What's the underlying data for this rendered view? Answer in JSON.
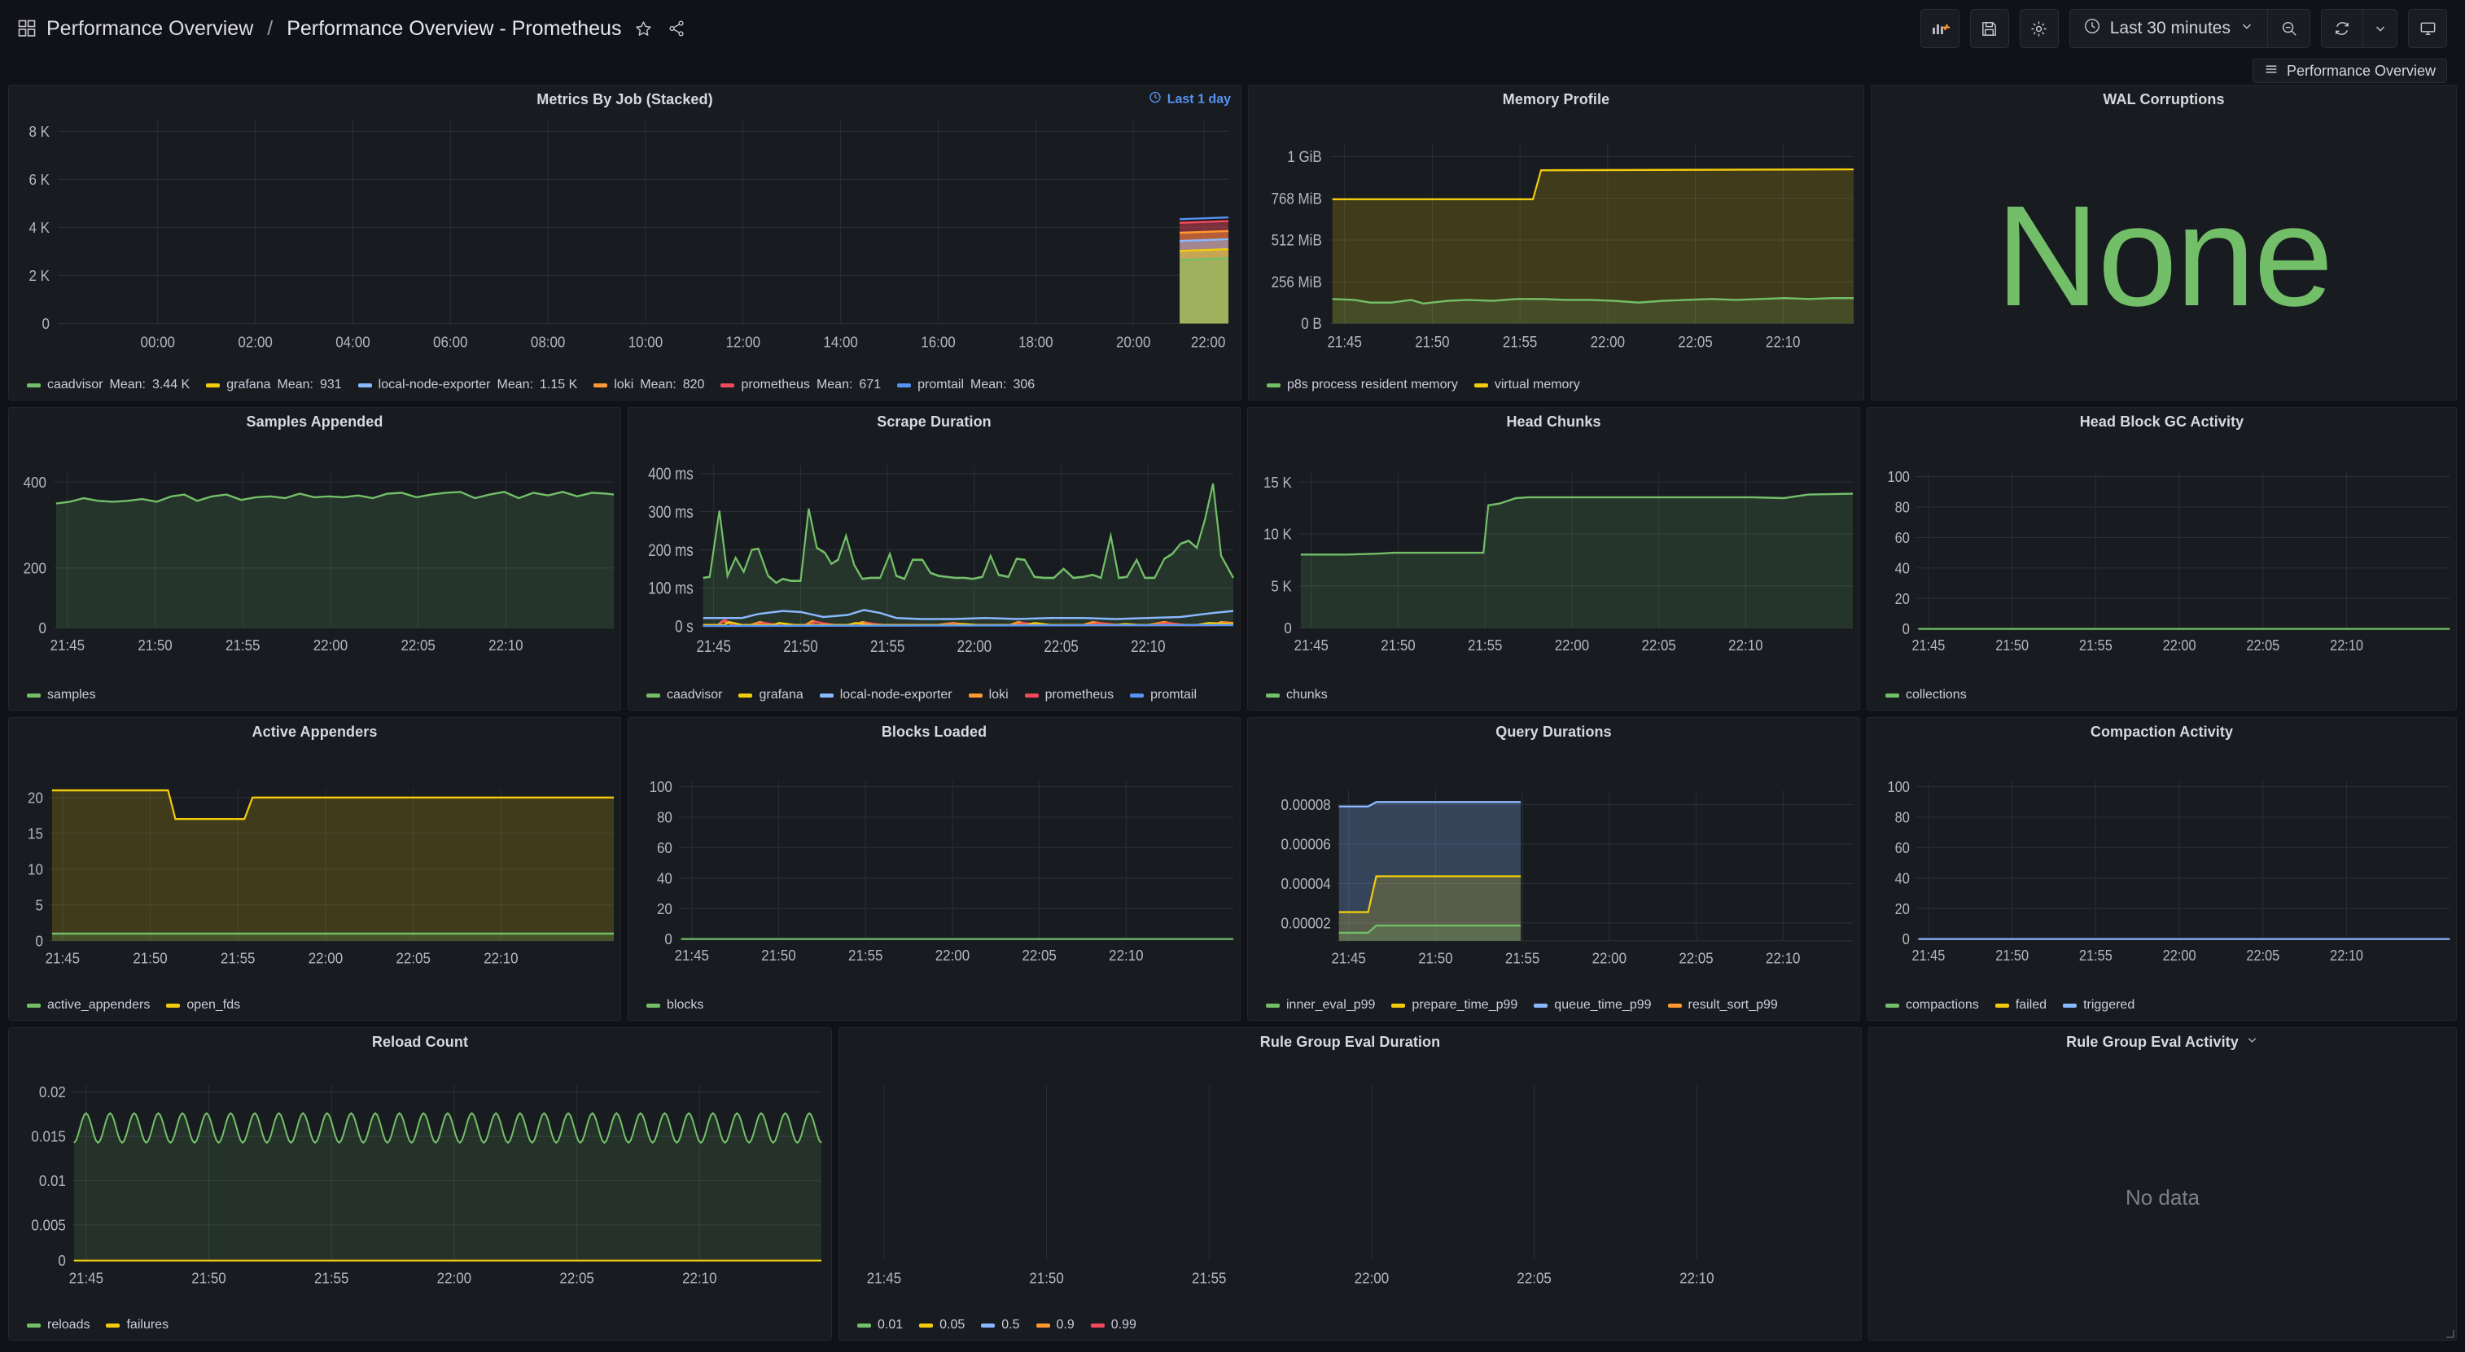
{
  "topbar": {
    "breadcrumb_root": "Performance Overview",
    "breadcrumb_sep": "/",
    "breadcrumb_current": "Performance Overview - Prometheus",
    "star_icon": "star-icon",
    "share_icon": "share-icon",
    "add_panel_label": "add-panel",
    "save_label": "save-dashboard",
    "settings_label": "dashboard-settings",
    "time_range": "Last 30 minutes",
    "clock_icon": "clock-icon",
    "caret_icon": "chevron-down-icon",
    "zoom_out_icon": "zoom-out-icon",
    "refresh_icon": "refresh-icon",
    "tv_icon": "tv-icon"
  },
  "subbar": {
    "dashboard_link": "Performance Overview",
    "menu_icon": "hamburger-icon"
  },
  "colors": {
    "green": "#73bf69",
    "yellow": "#f2cc0c",
    "blue": "#8ab8ff",
    "orange": "#ff9830",
    "red": "#f2495c",
    "blue2": "#5794f2",
    "accent": "#5794f2",
    "panel_bg": "#181b1f",
    "page_bg": "#111217",
    "text": "#ccccdc",
    "grid": "#2b2f36"
  },
  "chart_data": [
    {
      "id": "metrics-by-job",
      "type": "area",
      "title": "Metrics By Job (Stacked)",
      "badge": "Last 1 day",
      "stacked": true,
      "ylim": [
        0,
        9000
      ],
      "yticks": [
        "0",
        "2 K",
        "4 K",
        "6 K",
        "8 K"
      ],
      "ytick_values": [
        0,
        2000,
        4000,
        6000,
        8000
      ],
      "xticks": [
        "00:00",
        "02:00",
        "04:00",
        "06:00",
        "08:00",
        "10:00",
        "12:00",
        "14:00",
        "16:00",
        "18:00",
        "20:00",
        "22:00"
      ],
      "legend": [
        {
          "name": "caadvisor",
          "stat_label": "Mean:",
          "stat": "3.44 K",
          "color": "#73bf69",
          "value": 3440
        },
        {
          "name": "grafana",
          "stat_label": "Mean:",
          "stat": "931",
          "color": "#f2cc0c",
          "value": 931
        },
        {
          "name": "local-node-exporter",
          "stat_label": "Mean:",
          "stat": "1.15 K",
          "color": "#8ab8ff",
          "value": 1150
        },
        {
          "name": "loki",
          "stat_label": "Mean:",
          "stat": "820",
          "color": "#ff9830",
          "value": 820
        },
        {
          "name": "prometheus",
          "stat_label": "Mean:",
          "stat": "671",
          "color": "#f2495c",
          "value": 671
        },
        {
          "name": "promtail",
          "stat_label": "Mean:",
          "stat": "306",
          "color": "#5794f2",
          "value": 306
        }
      ],
      "note": "Series only present in the final ~2% of the time window (right edge), stacked to ~7.3 K"
    },
    {
      "id": "memory-profile",
      "type": "area",
      "title": "Memory Profile",
      "ylim": [
        0,
        1207959552
      ],
      "yticks": [
        "0 B",
        "256 MiB",
        "512 MiB",
        "768 MiB",
        "1 GiB"
      ],
      "ytick_values": [
        0,
        268435456,
        536870912,
        805306368,
        1073741824
      ],
      "xticks": [
        "21:45",
        "21:50",
        "21:55",
        "22:00",
        "22:05",
        "22:10"
      ],
      "series": [
        {
          "name": "p8s process resident memory",
          "color": "#73bf69",
          "values": [
            150,
            148,
            145,
            143,
            144,
            146,
            141,
            144,
            147,
            146,
            148,
            145,
            149,
            150,
            149,
            148,
            147,
            149,
            146,
            144,
            148,
            150,
            149,
            150,
            151,
            149,
            152,
            151,
            150,
            152
          ],
          "unit": "MiB"
        },
        {
          "name": "virtual memory",
          "color": "#f2cc0c",
          "values": [
            820,
            820,
            820,
            820,
            820,
            820,
            820,
            820,
            820,
            820,
            820,
            820,
            820,
            960,
            960,
            960,
            960,
            960,
            960,
            960,
            960,
            960,
            960,
            960,
            960,
            960,
            960,
            960,
            960,
            960
          ],
          "unit": "MiB"
        }
      ]
    },
    {
      "id": "wal-corruptions",
      "type": "stat",
      "title": "WAL Corruptions",
      "value": "None",
      "value_color": "#73bf69"
    },
    {
      "id": "samples-appended",
      "type": "area",
      "title": "Samples Appended",
      "ylim": [
        0,
        530
      ],
      "yticks": [
        "0",
        "200",
        "400"
      ],
      "ytick_values": [
        0,
        200,
        400
      ],
      "xticks": [
        "21:45",
        "21:50",
        "21:55",
        "22:00",
        "22:05",
        "22:10"
      ],
      "series": [
        {
          "name": "samples",
          "color": "#73bf69",
          "values": [
            455,
            458,
            468,
            463,
            461,
            459,
            462,
            465,
            461,
            470,
            478,
            463,
            472,
            476,
            465,
            470,
            472,
            468,
            480,
            471,
            474,
            470,
            477,
            470,
            467,
            475,
            480,
            481,
            472,
            478
          ]
        }
      ]
    },
    {
      "id": "scrape-duration",
      "type": "area",
      "title": "Scrape Duration",
      "ylim": [
        0,
        420
      ],
      "yticks": [
        "0 s",
        "100 ms",
        "200 ms",
        "300 ms",
        "400 ms"
      ],
      "ytick_values": [
        0,
        100,
        200,
        300,
        400
      ],
      "xticks": [
        "21:45",
        "21:50",
        "21:55",
        "22:00",
        "22:05",
        "22:10"
      ],
      "series": [
        {
          "name": "caadvisor",
          "color": "#73bf69",
          "values": [
            128,
            130,
            303,
            140,
            175,
            200,
            150,
            120,
            133,
            205,
            165,
            240,
            130,
            126,
            128,
            190,
            125,
            175,
            145,
            130,
            126,
            185,
            127,
            175,
            124,
            190,
            180,
            375
          ]
        },
        {
          "name": "grafana",
          "color": "#f2cc0c",
          "values": [
            3,
            3,
            12,
            4,
            10,
            3,
            3,
            3,
            9,
            4,
            8,
            3,
            3,
            3,
            3,
            8,
            3,
            3,
            4,
            8,
            3,
            3,
            4,
            3,
            3,
            5,
            6,
            10
          ]
        },
        {
          "name": "local-node-exporter",
          "color": "#8ab8ff",
          "values": [
            22,
            22,
            26,
            24,
            30,
            34,
            24,
            22,
            30,
            27,
            32,
            36,
            22,
            20,
            21,
            22,
            22,
            21,
            22,
            23,
            21,
            20,
            22,
            22,
            21,
            24,
            28,
            38
          ]
        },
        {
          "name": "loki",
          "color": "#ff9830",
          "values": [
            4,
            4,
            14,
            5,
            11,
            4,
            4,
            4,
            10,
            5,
            9,
            4,
            4,
            4,
            4,
            9,
            4,
            4,
            5,
            12,
            4,
            4,
            5,
            4,
            4,
            6,
            7,
            12
          ]
        },
        {
          "name": "prometheus",
          "color": "#f2495c",
          "values": [
            3,
            3,
            13,
            4,
            9,
            3,
            3,
            3,
            8,
            4,
            7,
            3,
            3,
            3,
            3,
            7,
            3,
            3,
            4,
            7,
            3,
            3,
            4,
            3,
            3,
            4,
            5,
            9
          ]
        },
        {
          "name": "promtail",
          "color": "#5794f2",
          "values": [
            2,
            2,
            3,
            2,
            3,
            2,
            2,
            2,
            3,
            2,
            3,
            2,
            2,
            2,
            2,
            3,
            2,
            2,
            2,
            3,
            2,
            2,
            2,
            2,
            2,
            2,
            3,
            4
          ]
        }
      ]
    },
    {
      "id": "head-chunks",
      "type": "area",
      "title": "Head Chunks",
      "ylim": [
        0,
        16500
      ],
      "yticks": [
        "0",
        "5 K",
        "10 K",
        "15 K"
      ],
      "ytick_values": [
        0,
        5000,
        10000,
        15000
      ],
      "xticks": [
        "21:45",
        "21:50",
        "21:55",
        "22:00",
        "22:05",
        "22:10"
      ],
      "series": [
        {
          "name": "chunks",
          "color": "#73bf69",
          "values": [
            7150,
            7150,
            7160,
            7200,
            7230,
            7240,
            7240,
            7240,
            7240,
            7240,
            7240,
            7250,
            13200,
            13400,
            13700,
            13720,
            13720,
            13720,
            13720,
            13720,
            13720,
            13720,
            13720,
            13720,
            13720,
            13730,
            13760,
            13900,
            14050,
            14080
          ]
        }
      ]
    },
    {
      "id": "head-block-gc",
      "type": "line",
      "title": "Head Block GC Activity",
      "ylim": [
        0,
        110
      ],
      "yticks": [
        "0",
        "20",
        "40",
        "60",
        "80",
        "100"
      ],
      "ytick_values": [
        0,
        20,
        40,
        60,
        80,
        100
      ],
      "xticks": [
        "21:45",
        "21:50",
        "21:55",
        "22:00",
        "22:05",
        "22:10"
      ],
      "series": [
        {
          "name": "collections",
          "color": "#73bf69",
          "values": [
            0,
            0,
            0,
            0,
            0,
            0,
            0,
            0,
            0,
            0,
            0,
            0,
            0,
            0,
            0,
            0,
            0,
            0,
            0,
            0,
            0,
            0,
            0,
            0,
            0,
            0,
            0,
            0,
            0,
            0
          ]
        }
      ]
    },
    {
      "id": "active-appenders",
      "type": "area",
      "title": "Active Appenders",
      "ylim": [
        0,
        22
      ],
      "yticks": [
        "0",
        "5",
        "10",
        "15",
        "20"
      ],
      "ytick_values": [
        0,
        5,
        10,
        15,
        20
      ],
      "xticks": [
        "21:45",
        "21:50",
        "21:55",
        "22:00",
        "22:05",
        "22:10"
      ],
      "series": [
        {
          "name": "active_appenders",
          "color": "#73bf69",
          "values": [
            1,
            1,
            1,
            1,
            1,
            1,
            1,
            1,
            1,
            1,
            1,
            1,
            1,
            1,
            1,
            1,
            1,
            1,
            1,
            1,
            1,
            1,
            1,
            1,
            1,
            1,
            1,
            1,
            1,
            1
          ]
        },
        {
          "name": "open_fds",
          "color": "#f2cc0c",
          "values": [
            21,
            21,
            21,
            21,
            21,
            21,
            21,
            21,
            18,
            18,
            18,
            18,
            18,
            20,
            20,
            20,
            20,
            20,
            20,
            20,
            20,
            20,
            20,
            20,
            20,
            20,
            20,
            20,
            20,
            20
          ]
        }
      ]
    },
    {
      "id": "blocks-loaded",
      "type": "line",
      "title": "Blocks Loaded",
      "ylim": [
        0,
        110
      ],
      "yticks": [
        "0",
        "20",
        "40",
        "60",
        "80",
        "100"
      ],
      "ytick_values": [
        0,
        20,
        40,
        60,
        80,
        100
      ],
      "xticks": [
        "21:45",
        "21:50",
        "21:55",
        "22:00",
        "22:05",
        "22:10"
      ],
      "series": [
        {
          "name": "blocks",
          "color": "#73bf69",
          "values": [
            0,
            0,
            0,
            0,
            0,
            0,
            0,
            0,
            0,
            0,
            0,
            0,
            0,
            0,
            0,
            0,
            0,
            0,
            0,
            0,
            0,
            0,
            0,
            0,
            0,
            0,
            0,
            0,
            0,
            0
          ]
        }
      ]
    },
    {
      "id": "query-durations",
      "type": "area",
      "title": "Query Durations",
      "stacked": true,
      "ylim": [
        0,
        9e-05
      ],
      "yticks": [
        "0.00002",
        "0.00004",
        "0.00006",
        "0.00008"
      ],
      "ytick_values": [
        2e-05,
        4e-05,
        6e-05,
        8e-05
      ],
      "xticks": [
        "21:45",
        "21:50",
        "21:55",
        "22:00",
        "22:05",
        "22:10"
      ],
      "series": [
        {
          "name": "inner_eval_p99",
          "color": "#73bf69",
          "values": [
            1.6e-05,
            1.6e-05,
            2.1e-05,
            2.1e-05,
            2.1e-05,
            2.1e-05,
            2.1e-05,
            2.1e-05,
            2.1e-05,
            2.1e-05,
            2.1e-05,
            2.1e-05
          ]
        },
        {
          "name": "prepare_time_p99",
          "color": "#f2cc0c",
          "values": [
            3.05e-05,
            3.05e-05,
            4.9e-05,
            4.9e-05,
            4.9e-05,
            4.9e-05,
            4.9e-05,
            4.9e-05,
            4.9e-05,
            4.9e-05,
            4.9e-05,
            4.9e-05
          ]
        },
        {
          "name": "queue_time_p99",
          "color": "#8ab8ff",
          "values": [
            8e-05,
            8e-05,
            8.25e-05,
            8.25e-05,
            8.25e-05,
            8.25e-05,
            8.25e-05,
            8.25e-05,
            8.25e-05,
            8.25e-05,
            8.25e-05,
            8.25e-05
          ]
        },
        {
          "name": "result_sort_p99",
          "color": "#ff9830",
          "values": [
            0,
            0,
            0,
            0,
            0,
            0,
            0,
            0,
            0,
            0,
            0,
            0
          ]
        }
      ],
      "note": "Data ends at approx 21:55; panel right half empty"
    },
    {
      "id": "compaction-activity",
      "type": "line",
      "title": "Compaction Activity",
      "ylim": [
        0,
        110
      ],
      "yticks": [
        "0",
        "20",
        "40",
        "60",
        "80",
        "100"
      ],
      "ytick_values": [
        0,
        20,
        40,
        60,
        80,
        100
      ],
      "xticks": [
        "21:45",
        "21:50",
        "21:55",
        "22:00",
        "22:05",
        "22:10"
      ],
      "series": [
        {
          "name": "compactions",
          "color": "#73bf69",
          "values": [
            0,
            0,
            0,
            0,
            0,
            0,
            0,
            0,
            0,
            0,
            0,
            0
          ]
        },
        {
          "name": "failed",
          "color": "#f2cc0c",
          "values": [
            0,
            0,
            0,
            0,
            0,
            0,
            0,
            0,
            0,
            0,
            0,
            0
          ]
        },
        {
          "name": "triggered",
          "color": "#8ab8ff",
          "values": [
            0,
            0,
            0,
            0,
            0,
            0,
            0,
            0,
            0,
            0,
            0,
            0
          ]
        }
      ]
    },
    {
      "id": "reload-count",
      "type": "area",
      "title": "Reload Count",
      "ylim": [
        0,
        0.0215
      ],
      "yticks": [
        "0",
        "0.005",
        "0.01",
        "0.015",
        "0.02"
      ],
      "ytick_values": [
        0,
        0.005,
        0.01,
        0.015,
        0.02
      ],
      "xticks": [
        "21:45",
        "21:50",
        "21:55",
        "22:00",
        "22:05",
        "22:10"
      ],
      "series": [
        {
          "name": "reloads",
          "color": "#73bf69",
          "oscillating": true,
          "min": 0.014,
          "max": 0.0175,
          "cycles": 31
        },
        {
          "name": "failures",
          "color": "#f2cc0c",
          "values": [
            0,
            0,
            0,
            0,
            0,
            0,
            0,
            0,
            0,
            0,
            0,
            0
          ]
        }
      ]
    },
    {
      "id": "rule-group-eval-duration",
      "type": "line",
      "title": "Rule Group Eval Duration",
      "ylim": [
        0,
        1
      ],
      "yticks": [],
      "ytick_values": [],
      "xticks": [
        "21:45",
        "21:50",
        "21:55",
        "22:00",
        "22:05",
        "22:10"
      ],
      "series": [
        {
          "name": "0.01",
          "color": "#73bf69",
          "values": []
        },
        {
          "name": "0.05",
          "color": "#f2cc0c",
          "values": []
        },
        {
          "name": "0.5",
          "color": "#8ab8ff",
          "values": []
        },
        {
          "name": "0.9",
          "color": "#ff9830",
          "values": []
        },
        {
          "name": "0.99",
          "color": "#f2495c",
          "values": []
        }
      ]
    },
    {
      "id": "rule-group-eval-activity",
      "type": "stat",
      "title": "Rule Group Eval Activity",
      "has_caret": true,
      "value": "No data"
    }
  ]
}
